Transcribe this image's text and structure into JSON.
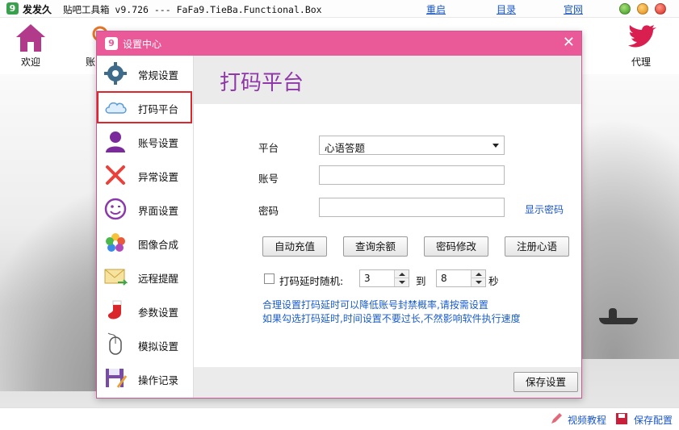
{
  "app": {
    "title": "发发久",
    "subtitle": "贴吧工具箱 v9.726 --- FaFa9.TieBa.Functional.Box",
    "links": {
      "restart": "重启",
      "catalog": "目录",
      "website": "官网"
    }
  },
  "toolbar": {
    "items": [
      {
        "label": "欢迎",
        "icon": "home-icon"
      },
      {
        "label": "账",
        "icon": "user-icon"
      },
      {
        "label": "代理",
        "icon": "bird-icon"
      }
    ]
  },
  "status": {
    "video_tutorial": "视频教程",
    "save_config": "保存配置"
  },
  "dialog": {
    "title": "设置中心",
    "close": "✕",
    "nav": [
      {
        "label": "常规设置",
        "icon": "gear-icon"
      },
      {
        "label": "打码平台",
        "icon": "cloud-icon"
      },
      {
        "label": "账号设置",
        "icon": "person-icon"
      },
      {
        "label": "异常设置",
        "icon": "x-mark-icon"
      },
      {
        "label": "界面设置",
        "icon": "smiley-icon"
      },
      {
        "label": "图像合成",
        "icon": "photos-icon"
      },
      {
        "label": "远程提醒",
        "icon": "mail-icon"
      },
      {
        "label": "参数设置",
        "icon": "stocking-icon"
      },
      {
        "label": "模拟设置",
        "icon": "mouse-icon"
      },
      {
        "label": "操作记录",
        "icon": "floppy-icon"
      }
    ],
    "active_nav": "打码平台",
    "content": {
      "heading": "打码平台",
      "platform_label": "平台",
      "platform_value": "心语答题",
      "account_label": "账号",
      "account_value": "",
      "password_label": "密码",
      "password_value": "",
      "show_password": "显示密码",
      "buttons": {
        "auto_recharge": "自动充值",
        "query_balance": "查询余额",
        "change_password": "密码修改",
        "register": "注册心语"
      },
      "delay_label": "打码延时随机:",
      "delay_checked": false,
      "delay_min": "3",
      "to_label": "到",
      "delay_max": "8",
      "seconds_label": "秒",
      "tip_line1": "合理设置打码延时可以降低账号封禁概率,请按需设置",
      "tip_line2": "如果勾选打码延时,时间设置不要过长,不然影响软件执行速度",
      "save_button": "保存设置"
    }
  },
  "colors": {
    "accent": "#ea5a98",
    "heading": "#8f38a8",
    "link": "#1a56c8",
    "active_border": "#e0262b"
  }
}
